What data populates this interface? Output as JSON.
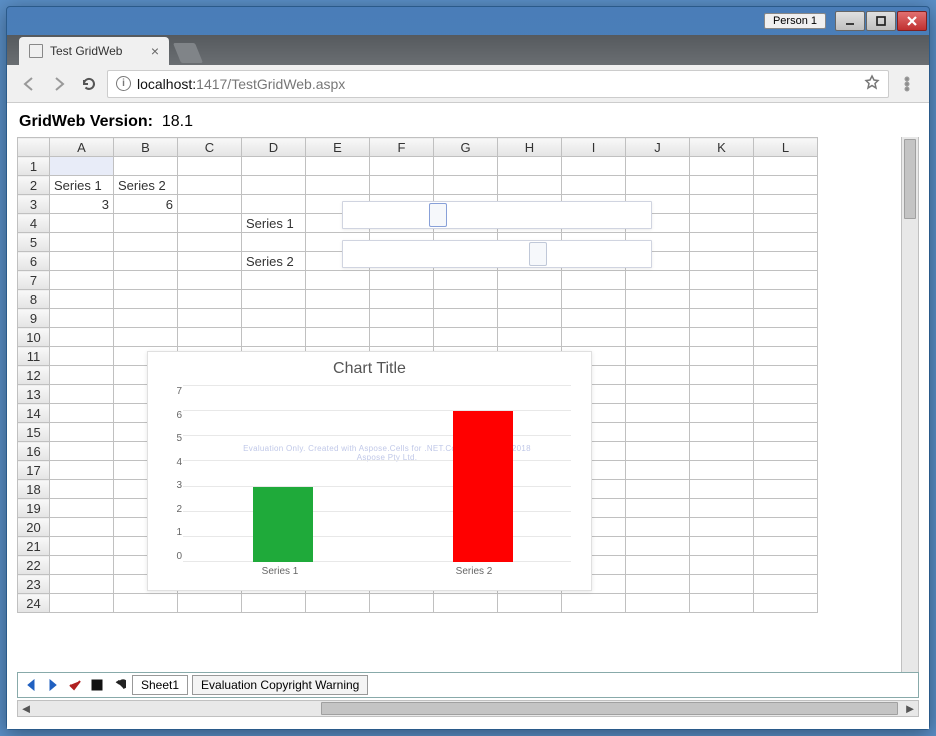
{
  "window": {
    "person_label": "Person 1"
  },
  "browser": {
    "tab_title": "Test GridWeb",
    "url_host": "localhost:",
    "url_port_path": "1417/TestGridWeb.aspx"
  },
  "page": {
    "version_label": "GridWeb Version:",
    "version_value": "18.1"
  },
  "grid": {
    "columns": [
      "A",
      "B",
      "C",
      "D",
      "E",
      "F",
      "G",
      "H",
      "I",
      "J",
      "K",
      "L"
    ],
    "rows": 24,
    "cells": {
      "A2": "Series 1",
      "B2": "Series 2",
      "A3": "3",
      "B3": "6",
      "D4": "Series 1",
      "D6": "Series 2"
    }
  },
  "overlays": {
    "series1_label": "Series 1",
    "series2_label": "Series 2"
  },
  "chart_data": {
    "type": "bar",
    "title": "Chart Title",
    "categories": [
      "Series 1",
      "Series 2"
    ],
    "values": [
      3,
      6
    ],
    "series_colors": [
      "#1faa3a",
      "#ff0000"
    ],
    "ylim": [
      0,
      7
    ],
    "yticks": [
      0,
      1,
      2,
      3,
      4,
      5,
      6,
      7
    ],
    "xlabel": "",
    "ylabel": "",
    "watermark": "Evaluation Only. Created with Aspose.Cells for .NET.Copyright 2003 - 2018 Aspose Pty Ltd."
  },
  "bottom": {
    "sheet_tab": "Sheet1",
    "warning_tab": "Evaluation Copyright Warning"
  }
}
